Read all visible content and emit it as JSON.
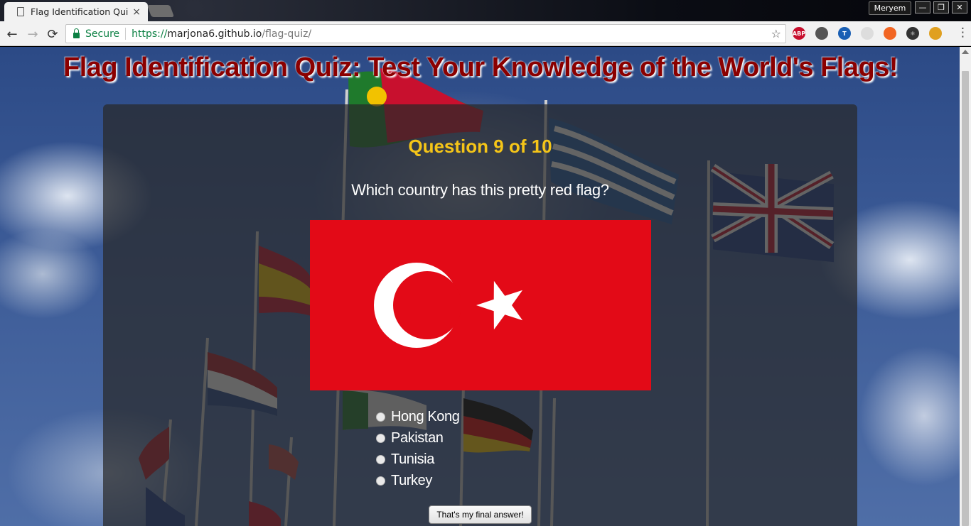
{
  "browser": {
    "tab_title": "Flag Identification Quiz",
    "tab_close": "×",
    "profile_name": "Meryem",
    "window_buttons": [
      "—",
      "❐",
      "✕"
    ],
    "nav": {
      "back": "←",
      "forward": "→",
      "reload": "⟳"
    },
    "security_label": "Secure",
    "url": {
      "scheme": "https://",
      "host": "marjona6.github.io",
      "path": "/flag-quiz/"
    },
    "bookmark_icon": "☆",
    "extensions": [
      {
        "name": "adblock-plus-icon",
        "label": "ABP",
        "color": "#c70d2c"
      },
      {
        "name": "pen-tool-icon",
        "label": "",
        "color": "#555555"
      },
      {
        "name": "tampermonkey-icon",
        "label": "T",
        "color": "#1a5fb4"
      },
      {
        "name": "circle-extension-icon",
        "label": "",
        "color": "#dddddd"
      },
      {
        "name": "orange-extension-icon",
        "label": "",
        "color": "#f26522"
      },
      {
        "name": "react-devtools-icon",
        "label": "⚛",
        "color": "#333333"
      },
      {
        "name": "owl-extension-icon",
        "label": "",
        "color": "#e0a020"
      }
    ],
    "menu": "⋮"
  },
  "page": {
    "title": "Flag Identification Quiz: Test Your Knowledge of the World's Flags!",
    "quiz": {
      "counter": "Question 9 of 10",
      "question": "Which country has this pretty red flag?",
      "flag_colors": {
        "field": "#e30a17",
        "emblem": "#ffffff"
      },
      "options": [
        "Hong Kong",
        "Pakistan",
        "Tunisia",
        "Turkey"
      ],
      "submit_label": "That's my final answer!"
    }
  },
  "colors": {
    "title": "#8b0000",
    "counter": "#f5c518",
    "panel": "rgba(40,40,40,0.72)",
    "secure_green": "#0b8043"
  }
}
